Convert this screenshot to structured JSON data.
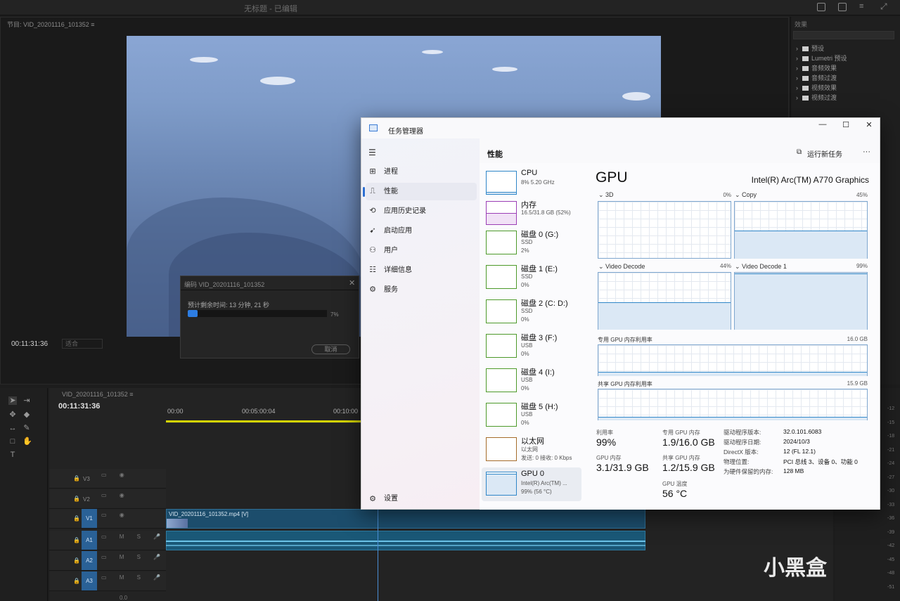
{
  "premiere": {
    "title": "无标题 - 已编辑",
    "monitor_label": "节目: VID_20201116_101352 ≡",
    "monitor_timecode": "00:11:31:36",
    "fit_value": "适合",
    "effects_items": [
      "预设",
      "Lumetri 预设",
      "音频效果",
      "音频过渡",
      "视频效果",
      "视频过渡"
    ],
    "effects_header": "效果",
    "timeline_tab": "VID_20201116_101352 ≡",
    "timeline_timecode": "00:11:31:36",
    "ruler_ticks": [
      "00:00",
      "00:05:00:04",
      "00:10:00"
    ],
    "tracks": [
      "V3",
      "V2",
      "V1",
      "A1",
      "A2",
      "A3"
    ],
    "tags": [
      "V1",
      "A1",
      "A2",
      "A3"
    ],
    "clip_label": "VID_20201116_101352.mp4 [V]",
    "bottom_value": "0.0",
    "db_labels": [
      "-12",
      "-15",
      "-18",
      "-21",
      "-24",
      "-27",
      "-30",
      "-33",
      "-36",
      "-39",
      "-42",
      "-45",
      "-48",
      "-51"
    ]
  },
  "encode_dialog": {
    "title": "编码 VID_20201116_101352",
    "remaining": "预计剩余时间: 13 分钟, 21 秒",
    "percent_text": "7%",
    "progress": 0.07,
    "cancel": "取消"
  },
  "task_manager": {
    "title": "任务管理器",
    "nav": [
      "进程",
      "性能",
      "应用历史记录",
      "启动应用",
      "用户",
      "详细信息",
      "服务"
    ],
    "nav_selected": 1,
    "settings": "设置",
    "section": "性能",
    "run_task": "运行新任务",
    "more": "···",
    "resources": [
      {
        "name": "CPU",
        "sub1": "8% 5.20 GHz",
        "sub2": "",
        "color": "#2f86c8"
      },
      {
        "name": "内存",
        "sub1": "16.5/31.8 GB (52%)",
        "sub2": "",
        "color": "#9b3fb5"
      },
      {
        "name": "磁盘 0 (G:)",
        "sub1": "SSD",
        "sub2": "2%",
        "color": "#4d9a2a"
      },
      {
        "name": "磁盘 1 (E:)",
        "sub1": "SSD",
        "sub2": "0%",
        "color": "#4d9a2a"
      },
      {
        "name": "磁盘 2 (C: D:)",
        "sub1": "SSD",
        "sub2": "0%",
        "color": "#4d9a2a"
      },
      {
        "name": "磁盘 3 (F:)",
        "sub1": "USB",
        "sub2": "0%",
        "color": "#4d9a2a"
      },
      {
        "name": "磁盘 4 (I:)",
        "sub1": "USB",
        "sub2": "0%",
        "color": "#4d9a2a"
      },
      {
        "name": "磁盘 5 (H:)",
        "sub1": "USB",
        "sub2": "0%",
        "color": "#4d9a2a"
      },
      {
        "name": "以太网",
        "sub1": "以太网",
        "sub2": "发送: 0 接收: 0 Kbps",
        "color": "#a56c2b"
      },
      {
        "name": "GPU 0",
        "sub1": "Intel(R) Arc(TM) ...",
        "sub2": "99% (56 °C)",
        "color": "#2f86c8"
      }
    ],
    "gpu": {
      "heading": "GPU",
      "model": "Intel(R) Arc(TM) A770 Graphics",
      "engines": [
        {
          "label": "3D",
          "pct": "0%"
        },
        {
          "label": "Copy",
          "pct": "45%"
        },
        {
          "label": "Video Decode",
          "pct": "44%"
        },
        {
          "label": "Video Decode 1",
          "pct": "99%"
        }
      ],
      "dedicated_label": "专用 GPU 内存利用率",
      "dedicated_max": "16.0 GB",
      "shared_label": "共享 GPU 内存利用率",
      "shared_max": "15.9 GB",
      "stats": {
        "util_l": "利用率",
        "util_v": "99%",
        "ded_l": "专用 GPU 内存",
        "ded_v": "1.9/16.0 GB",
        "gpumem_l": "GPU 内存",
        "gpumem_v": "3.1/31.9 GB",
        "shared_l": "共享 GPU 内存",
        "shared_v": "1.2/15.9 GB",
        "temp_l": "GPU 温度",
        "temp_v": "56 °C"
      },
      "details": [
        {
          "k": "驱动程序版本:",
          "v": "32.0.101.6083"
        },
        {
          "k": "驱动程序日期:",
          "v": "2024/10/3"
        },
        {
          "k": "DirectX 版本:",
          "v": "12 (FL 12.1)"
        },
        {
          "k": "物理位置:",
          "v": "PCI 总线 3、设备 0、功能 0"
        },
        {
          "k": "为硬件保留的内存:",
          "v": "128 MB"
        }
      ]
    }
  },
  "watermark": "小黑盒"
}
